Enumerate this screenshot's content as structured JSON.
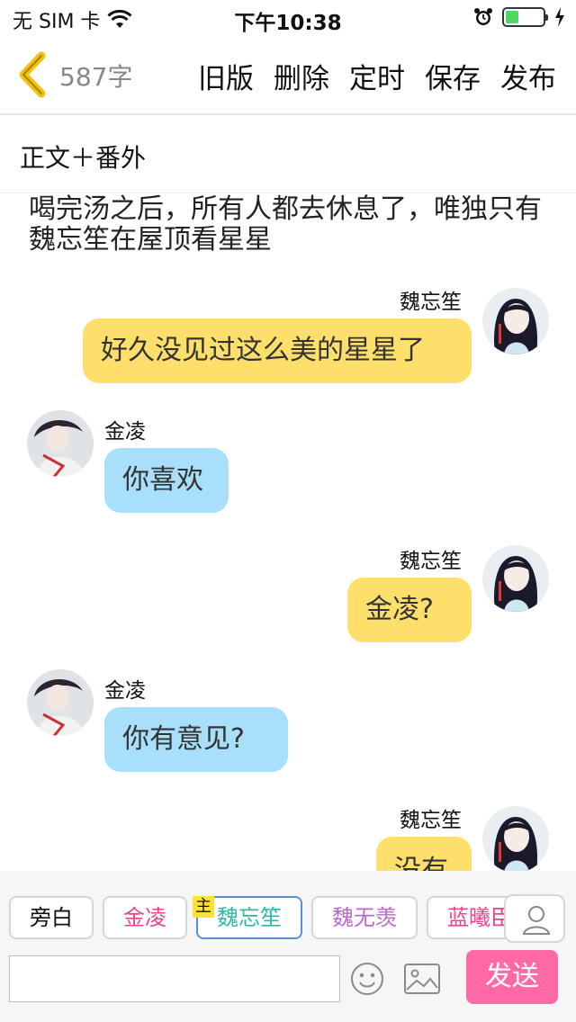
{
  "status_bar": {
    "carrier": "无 SIM 卡",
    "time": "下午10:38",
    "battery_level": 0.35,
    "wifi_icon": "wifi-icon",
    "alarm_icon": "alarm-icon",
    "charging_icon": "bolt-icon"
  },
  "nav": {
    "word_count": "587字",
    "actions": [
      "旧版",
      "删除",
      "定时",
      "保存",
      "发布"
    ],
    "accent_color": "#f4c20d"
  },
  "subtitle": "正文＋番外",
  "chat": {
    "narration": "喝完汤之后，所有人都去休息了，唯独只有魏忘笙在屋顶看星星",
    "messages": [
      {
        "speaker": "魏忘笙",
        "text": "好久没见过这么美的星星了",
        "side": "right",
        "color": "#ffdf6b"
      },
      {
        "speaker": "金凌",
        "text": "你喜欢",
        "side": "left",
        "color": "#a8dffb"
      },
      {
        "speaker": "魏忘笙",
        "text": "金凌?",
        "side": "right",
        "color": "#ffdf6b"
      },
      {
        "speaker": "金凌",
        "text": "你有意见?",
        "side": "left",
        "color": "#a8dffb"
      },
      {
        "speaker": "魏忘笙",
        "text": "没有",
        "side": "right",
        "color": "#ffdf6b"
      }
    ]
  },
  "characters": {
    "chips": [
      {
        "label": "旁白",
        "color": "#111111"
      },
      {
        "label": "金凌",
        "color": "#e8468c"
      },
      {
        "label": "魏忘笙",
        "color": "#2fb8a6"
      },
      {
        "label": "魏无羡",
        "color": "#b86ac9"
      },
      {
        "label": "蓝曦臣",
        "color": "#e8468c"
      }
    ],
    "main_badge": "主",
    "selected_index": 2
  },
  "composer": {
    "input_value": "",
    "send_label": "发送",
    "send_color": "#ff6aa6"
  }
}
